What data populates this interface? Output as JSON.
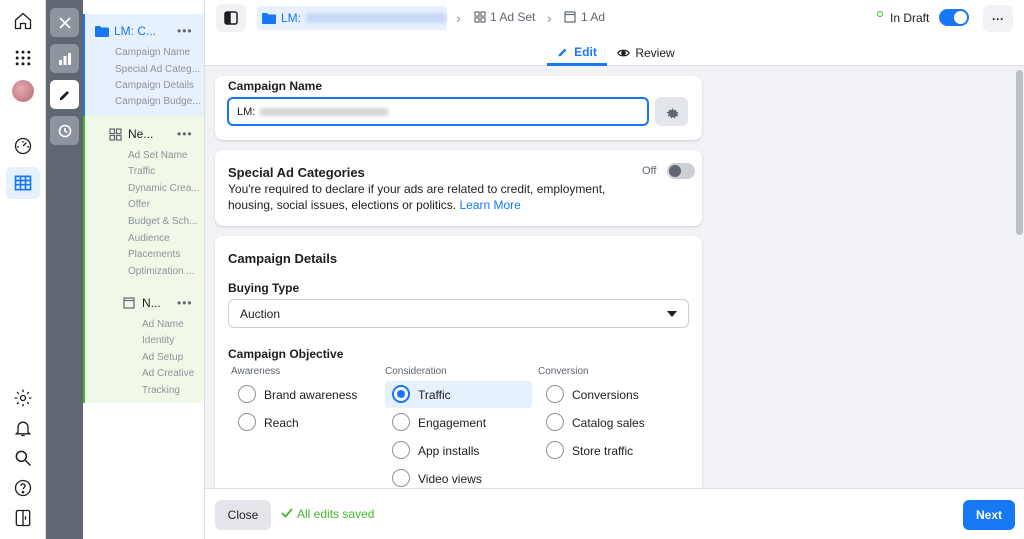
{
  "rail": {
    "icons": [
      "home-icon",
      "apps-grid-icon",
      "avatar",
      "dashboard-icon",
      "table-icon",
      "settings-icon",
      "bell-icon",
      "search-icon",
      "help-icon",
      "panel-icon"
    ]
  },
  "tree": {
    "campaign": {
      "title": "LM: C...",
      "items": [
        "Campaign Name",
        "Special Ad Categ...",
        "Campaign Details",
        "Campaign Budge..."
      ]
    },
    "adset": {
      "title": "Ne...",
      "items": [
        "Ad Set Name",
        "Traffic",
        "Dynamic Crea...",
        "Offer",
        "Budget & Sch...",
        "Audience",
        "Placements",
        "Optimization ..."
      ]
    },
    "ad": {
      "title": "N...",
      "items": [
        "Ad Name",
        "Identity",
        "Ad Setup",
        "Ad Creative",
        "Tracking"
      ]
    }
  },
  "topbar": {
    "breadcrumb_campaign": "LM:",
    "breadcrumb_adset": "1 Ad Set",
    "breadcrumb_ad": "1 Ad",
    "status": "In Draft",
    "tab_edit": "Edit",
    "tab_review": "Review",
    "more": "···"
  },
  "campaign_name": {
    "heading": "Campaign Name",
    "value": "LM:"
  },
  "special": {
    "heading": "Special Ad Categories",
    "desc": "You're required to declare if your ads are related to credit, employment, housing, social issues, elections or politics.",
    "link": "Learn More",
    "toggle_label": "Off"
  },
  "details": {
    "heading": "Campaign Details",
    "buying_type_label": "Buying Type",
    "buying_type_value": "Auction",
    "objective_label": "Campaign Objective",
    "col_awareness": "Awareness",
    "col_consideration": "Consideration",
    "col_conversion": "Conversion",
    "awareness": [
      "Brand awareness",
      "Reach"
    ],
    "consideration": [
      "Traffic",
      "Engagement",
      "App installs",
      "Video views"
    ],
    "conversion": [
      "Conversions",
      "Catalog sales",
      "Store traffic"
    ]
  },
  "footer": {
    "close": "Close",
    "saved": "All edits saved",
    "next": "Next"
  },
  "colors": {
    "accent": "#1877f2",
    "saved": "#42b72a"
  }
}
